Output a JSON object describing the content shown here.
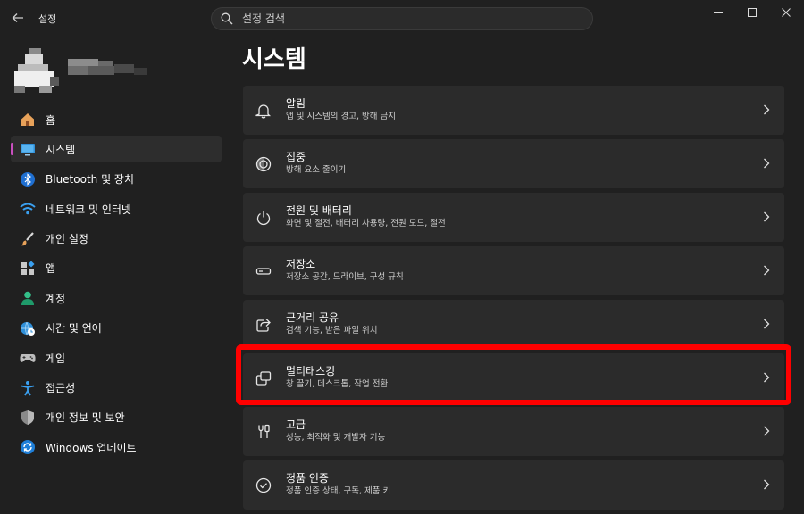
{
  "titlebar": {
    "app_title": "설정",
    "search_placeholder": "설정 검색"
  },
  "sidebar": {
    "items": [
      {
        "label": "홈",
        "icon": "home-icon"
      },
      {
        "label": "시스템",
        "icon": "system-monitor-icon",
        "selected": true
      },
      {
        "label": "Bluetooth 및 장치",
        "icon": "bluetooth-icon"
      },
      {
        "label": "네트워크 및 인터넷",
        "icon": "wifi-icon"
      },
      {
        "label": "개인 설정",
        "icon": "paintbrush-icon"
      },
      {
        "label": "앱",
        "icon": "apps-icon"
      },
      {
        "label": "계정",
        "icon": "person-icon"
      },
      {
        "label": "시간 및 언어",
        "icon": "globe-clock-icon"
      },
      {
        "label": "게임",
        "icon": "gamepad-icon"
      },
      {
        "label": "접근성",
        "icon": "accessibility-icon"
      },
      {
        "label": "개인 정보 및 보안",
        "icon": "shield-icon"
      },
      {
        "label": "Windows 업데이트",
        "icon": "update-icon"
      }
    ]
  },
  "main": {
    "title": "시스템",
    "cards": [
      {
        "title": "알림",
        "subtitle": "앱 및 시스템의 경고, 방해 금지",
        "icon": "bell-icon"
      },
      {
        "title": "집중",
        "subtitle": "방해 요소 줄이기",
        "icon": "focus-icon"
      },
      {
        "title": "전원 및 배터리",
        "subtitle": "화면 및 절전, 배터리 사용량, 전원 모드, 절전",
        "icon": "power-icon"
      },
      {
        "title": "저장소",
        "subtitle": "저장소 공간, 드라이브, 구성 규칙",
        "icon": "storage-icon"
      },
      {
        "title": "근거리 공유",
        "subtitle": "검색 기능, 받은 파일 위치",
        "icon": "share-icon"
      },
      {
        "title": "멀티태스킹",
        "subtitle": "창 끌기, 데스크톱, 작업 전환",
        "icon": "multitasking-icon",
        "highlighted": true
      },
      {
        "title": "고급",
        "subtitle": "성능, 최적화 및 개발자 기능",
        "icon": "tools-icon"
      },
      {
        "title": "정품 인증",
        "subtitle": "정품 인증 상태, 구독, 제품 키",
        "icon": "check-circle-icon"
      }
    ]
  },
  "colors": {
    "background": "#202020",
    "card": "#2b2b2b",
    "selected_nav": "#2d2d2d",
    "accent_indicator": "#c94fbf",
    "highlight": "#ff0000"
  }
}
